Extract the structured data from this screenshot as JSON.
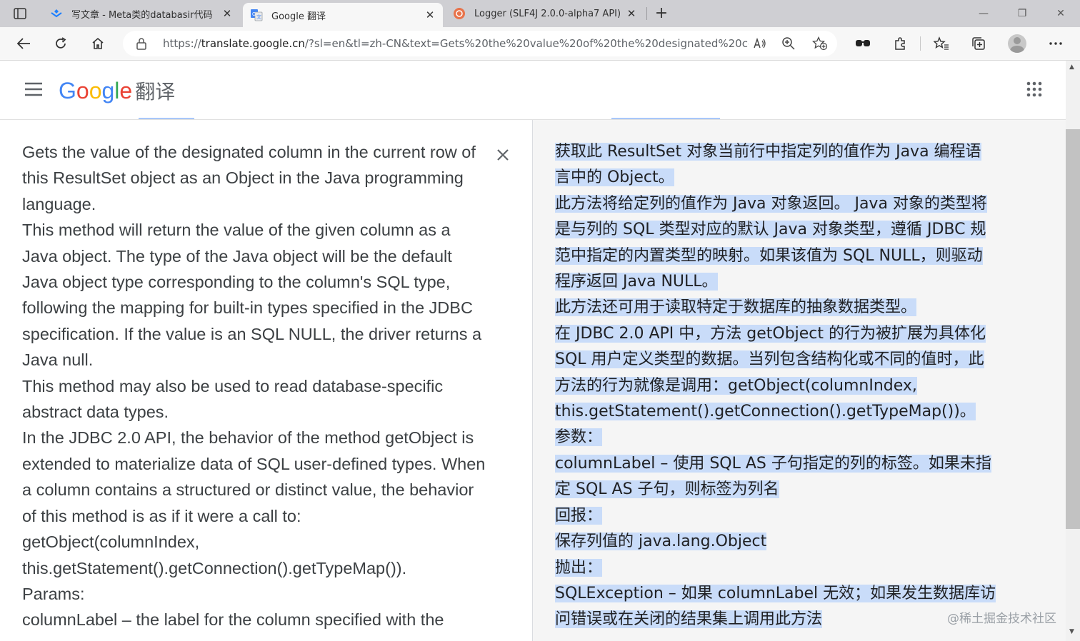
{
  "browser": {
    "tabs": [
      {
        "title": "写文章 - Meta类的databasir代码",
        "close": "✕"
      },
      {
        "title": "Google 翻译",
        "close": "✕"
      },
      {
        "title": "Logger (SLF4J 2.0.0-alpha7 API)",
        "close": "✕"
      }
    ],
    "new_tab": "+",
    "url_prefix": "https://",
    "url_host": "translate.google.cn",
    "url_rest": "/?sl=en&tl=zh-CN&text=Gets%20the%20value%20of%20the%20designated%20co...",
    "window_controls": [
      "—",
      "❐",
      "✕"
    ]
  },
  "header": {
    "logo_letters": [
      "G",
      "o",
      "o",
      "g",
      "l",
      "e"
    ],
    "product": "翻译"
  },
  "source_panel": {
    "lines": [
      "Gets the value of the designated column in the current row of",
      "this ResultSet object as an Object in the Java programming",
      "language.",
      "This method will return the value of the given column as a",
      "Java object. The type of the Java object will be the default",
      "Java object type corresponding to the column's SQL type,",
      "following the mapping for built-in types specified in the JDBC",
      "specification. If the value is an SQL NULL, the driver returns a",
      "Java null.",
      "This method may also be used to read database-specific",
      "abstract data types.",
      "In the JDBC 2.0 API, the behavior of the method getObject is",
      "extended to materialize data of SQL user-defined types. When",
      "a column contains a structured or distinct value, the behavior",
      "of this method is as if it were a call to:",
      "getObject(columnIndex,",
      "this.getStatement().getConnection().getTypeMap()).",
      "Params:",
      "columnLabel – the label for the column specified with the"
    ]
  },
  "target_panel": {
    "lines": [
      "获取此 ResultSet 对象当前行中指定列的值作为 Java 编程语",
      "言中的 Object。",
      "此方法将给定列的值作为 Java 对象返回。 Java 对象的类型将",
      "是与列的 SQL 类型对应的默认 Java 对象类型，遵循 JDBC 规",
      "范中指定的内置类型的映射。如果该值为 SQL NULL，则驱动",
      "程序返回 Java NULL。",
      "此方法还可用于读取特定于数据库的抽象数据类型。",
      "在 JDBC 2.0 API 中，方法 getObject 的行为被扩展为具体化",
      "SQL 用户定义类型的数据。当列包含结构化或不同的值时，此",
      "方法的行为就像是调用：getObject(columnIndex,",
      "this.getStatement().getConnection().getTypeMap())。",
      "参数：",
      "columnLabel – 使用 SQL AS 子句指定的列的标签。如果未指",
      "定 SQL AS 子句，则标签为列名",
      "回报：",
      "保存列值的 java.lang.Object",
      "抛出：",
      "SQLException – 如果 columnLabel 无效；如果发生数据库访",
      "问错误或在关闭的结果集上调用此方法"
    ],
    "watermark": "@稀土掘金技术社区"
  },
  "colors": {
    "highlight": "#c9dcf9",
    "target_bg": "#f5f5f5",
    "tabbar": "#cfcfd3"
  }
}
